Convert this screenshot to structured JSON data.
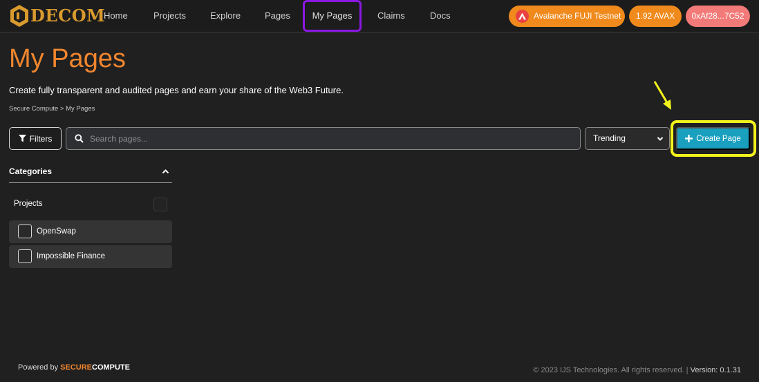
{
  "app": {
    "logo_text": "DECOM"
  },
  "nav": {
    "items": [
      "Home",
      "Projects",
      "Explore",
      "Pages",
      "My Pages",
      "Claims",
      "Docs"
    ],
    "active": "My Pages"
  },
  "wallet": {
    "network": "Avalanche FUJI Testnet",
    "balance": "1.92 AVAX",
    "address": "0xAf28...7C52"
  },
  "header": {
    "title": "My Pages",
    "subtitle": "Create fully transparent and audited pages and earn your share of the Web3 Future.",
    "breadcrumb": "Secure Compute > My Pages"
  },
  "toolbar": {
    "filters_label": "Filters",
    "search_placeholder": "Search pages...",
    "sort_selected": "Trending",
    "create_label": "Create Page"
  },
  "sidebar": {
    "categories_title": "Categories",
    "group_label": "Projects",
    "items": [
      "OpenSwap",
      "Impossible Finance"
    ]
  },
  "footer": {
    "powered_by": "Powered by",
    "brand_part1": "SECURE",
    "brand_part2": "COMPUTE",
    "copyright": "© 2023 IJS Technologies. All rights reserved. |",
    "version": "Version: 0.1.31"
  },
  "colors": {
    "accent": "#f2862e",
    "primary_button": "#1aa0bf",
    "active_nav_outline": "#8a18e0",
    "annotation_highlight": "#f2f21c"
  },
  "icons": [
    "logo-hex-icon",
    "avalanche-icon",
    "filter-icon",
    "search-icon",
    "chevron-down-icon",
    "plus-icon",
    "chevron-up-icon",
    "annotation-arrow-icon"
  ]
}
